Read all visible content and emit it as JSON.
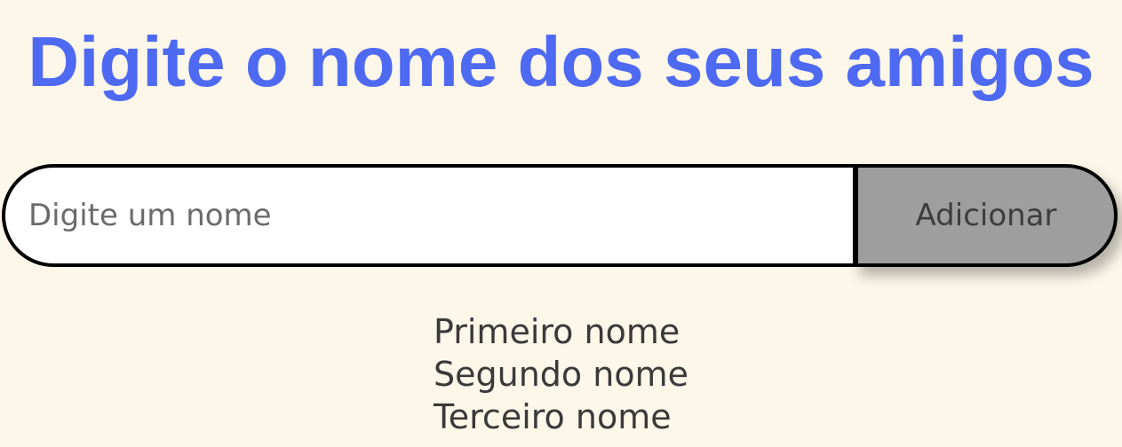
{
  "header": {
    "title": "Digite o nome dos seus amigos"
  },
  "form": {
    "input_value": "",
    "input_placeholder": "Digite um nome",
    "add_button_label": "Adicionar"
  },
  "names": [
    "Primeiro nome",
    "Segundo nome",
    "Terceiro nome"
  ],
  "colors": {
    "background": "#fdf7ea",
    "title": "#4f6af2",
    "button_bg": "#9e9e9e",
    "border": "#000000"
  }
}
